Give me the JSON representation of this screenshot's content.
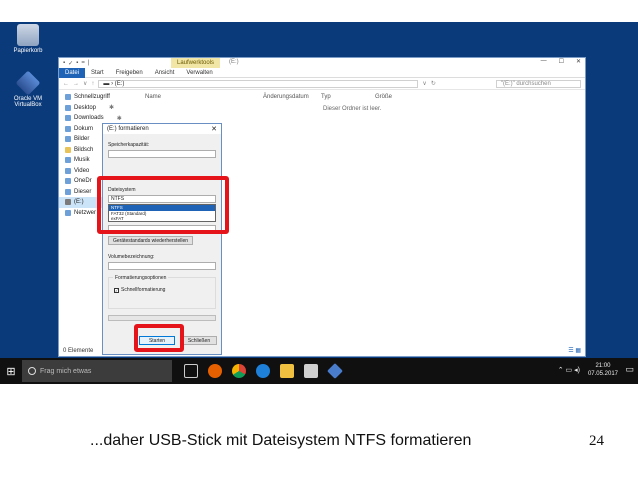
{
  "desktop": {
    "icons": [
      {
        "label": "Papierkorb"
      },
      {
        "label": "Oracle VM VirtualBox"
      }
    ]
  },
  "explorer": {
    "quick_access": [
      "▪",
      "✓",
      "▪",
      "=",
      "|"
    ],
    "context_tab": "Laufwerktools",
    "title": "(E:)",
    "window_controls": [
      "—",
      "☐",
      "✕"
    ],
    "ribbon_tabs": [
      "Datei",
      "Start",
      "Freigeben",
      "Ansicht",
      "Verwalten"
    ],
    "nav_buttons": [
      "←",
      "→",
      "∨",
      "↑"
    ],
    "address": "▬ › (E:)",
    "address_controls": [
      "∨",
      "↻"
    ],
    "search_placeholder": "\"(E:)\" durchsuchen",
    "columns": [
      "Name",
      "Änderungsdatum",
      "Typ",
      "Größe"
    ],
    "empty_text": "Dieser Ordner ist leer.",
    "nav_items": [
      {
        "label": "Schnellzugriff",
        "pin": ""
      },
      {
        "label": "Desktop",
        "pin": "✱"
      },
      {
        "label": "Downloads",
        "pin": "✱"
      },
      {
        "label": "Dokum",
        "pin": ""
      },
      {
        "label": "Bilder",
        "pin": ""
      },
      {
        "label": "Bildsch",
        "pin": ""
      },
      {
        "label": "Musik",
        "pin": ""
      },
      {
        "label": "Video",
        "pin": ""
      },
      {
        "label": "OneDr",
        "pin": ""
      },
      {
        "label": "Dieser",
        "pin": ""
      },
      {
        "label": "(E:)",
        "pin": ""
      },
      {
        "label": "Netzwer",
        "pin": ""
      }
    ],
    "status": "0 Elemente",
    "view_icons": "☰ ▦"
  },
  "dialog": {
    "title": "(E:) formatieren",
    "close": "✕",
    "capacity_label": "Speicherkapazität:",
    "filesystem_label": "Dateisystem",
    "filesystem_value": "NTFS",
    "filesystem_options": [
      "NTFS",
      "FAT32 (Standard)",
      "exFAT"
    ],
    "restore_button": "Gerätestandards wiederherstellen",
    "volume_label": "Volumebezeichnung:",
    "options_group": "Formatierungsoptionen",
    "quickformat_label": "Schnellformatierung",
    "quickformat_checked": true,
    "start_button": "Starten",
    "close_button": "Schließen"
  },
  "taskbar": {
    "start_icon": "⊞",
    "search_placeholder": "Frag mich etwas",
    "apps": [
      "task-view",
      "firefox",
      "chrome",
      "edge",
      "explorer",
      "store",
      "virtualbox"
    ],
    "tray_icons": "⌃ ▭ ◂)",
    "time": "21:00",
    "date": "07.05.2017",
    "notification_icon": "▭"
  },
  "slide": {
    "caption": "...daher USB-Stick mit Dateisystem NTFS formatieren",
    "page_number": "24"
  },
  "colors": {
    "desktop_bg": "#0b3a7a",
    "highlight": "#e5141b",
    "accent": "#1e63b6",
    "taskbar": "#101010"
  }
}
